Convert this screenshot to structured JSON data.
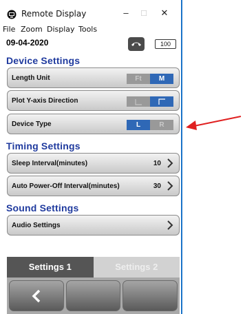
{
  "window": {
    "title": "Remote Display",
    "controls": {
      "minimize": "–",
      "maximize": "□",
      "close": "✕"
    }
  },
  "menu": [
    "File",
    "Zoom",
    "Display",
    "Tools"
  ],
  "header": {
    "date": "09-04-2020",
    "battery": "100",
    "phone_icon": "phone-icon"
  },
  "sections": {
    "device": {
      "title": "Device Settings",
      "length_unit": {
        "label": "Length Unit",
        "options": [
          "Ft",
          "M"
        ],
        "selected": "M"
      },
      "plot_y": {
        "label": "Plot Y-axis Direction"
      },
      "device_type": {
        "label": "Device Type",
        "options": [
          "L",
          "R"
        ],
        "selected": "L"
      }
    },
    "timing": {
      "title": "Timing Settings",
      "sleep": {
        "label": "Sleep Interval(minutes)",
        "value": "10"
      },
      "auto_off": {
        "label": "Auto Power-Off Interval(minutes)",
        "value": "30"
      }
    },
    "sound": {
      "title": "Sound Settings",
      "audio": {
        "label": "Audio Settings"
      }
    }
  },
  "tabs": [
    "Settings 1",
    "Settings 2"
  ],
  "colors": {
    "accent": "#1f3a9e",
    "selected": "#2f68b6",
    "annotation_arrow": "#e02020"
  }
}
